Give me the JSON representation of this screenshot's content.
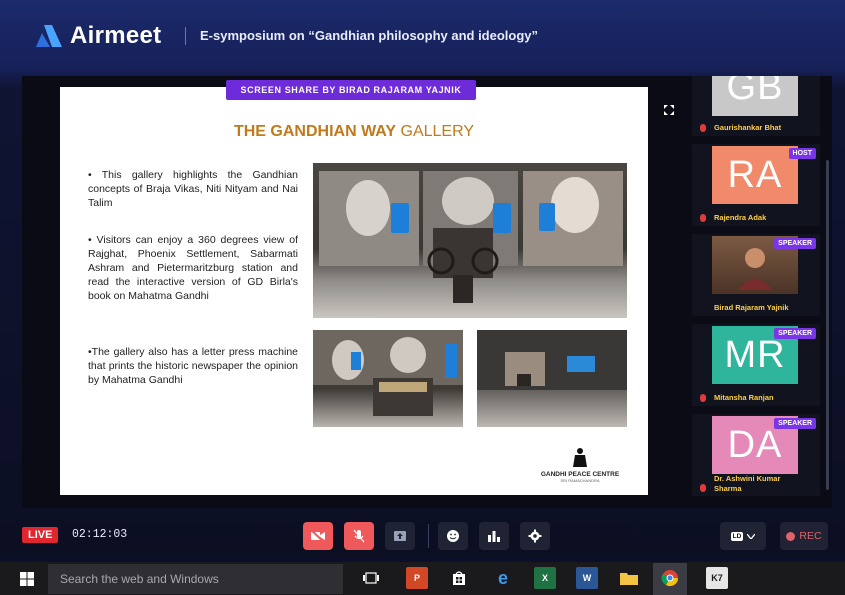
{
  "header": {
    "brand": "Airmeet",
    "event_title": "E-symposium on “Gandhian philosophy and ideology”"
  },
  "stage": {
    "share_badge": "SCREEN SHARE BY BIRAD RAJARAM YAJNIK",
    "slide": {
      "title_bold": "THE GANDHIAN WAY",
      "title_rest": " GALLERY",
      "bullets": [
        "• This gallery highlights the Gandhian concepts of Braja Vikas, Niti Nityam and Nai Talim",
        "• Visitors can enjoy a 360 degrees view of Rajghat, Phoenix Settlement, Sabarmati Ashram and Pietermaritzburg station and read the interactive version of GD Birla's book on Mahatma Gandhi",
        "•The gallery also has a letter press machine that prints the historic newspaper the opinion by Mahatma Gandhi"
      ],
      "logo_text": "GANDHI PEACE CENTRE",
      "logo_sub": "SRI RAMACHANDRA"
    }
  },
  "participants": [
    {
      "initials": "GB",
      "name": "Gaurishankar Bhat",
      "role": "",
      "color": "#c8c8c8"
    },
    {
      "initials": "RA",
      "name": "Rajendra Adak",
      "role": "HOST",
      "color": "#f08a6a"
    },
    {
      "initials": "",
      "name": "Birad Rajaram Yajnik",
      "role": "SPEAKER",
      "color": "#6b4a3a"
    },
    {
      "initials": "MR",
      "name": "Mitansha Ranjan",
      "role": "SPEAKER",
      "color": "#2fb59c"
    },
    {
      "initials": "DA",
      "name": "Dr. Ashwini Kumar Sharma",
      "role": "SPEAKER",
      "color": "#e58ab8"
    }
  ],
  "controls": {
    "live_label": "LIVE",
    "elapsed": "02:12:03",
    "quality": "LD",
    "record_label": "REC"
  },
  "taskbar": {
    "search_placeholder": "Search the web and Windows"
  },
  "colors": {
    "accent": "#6e2bd9",
    "danger": "#f0595b",
    "live": "#e0262f"
  }
}
